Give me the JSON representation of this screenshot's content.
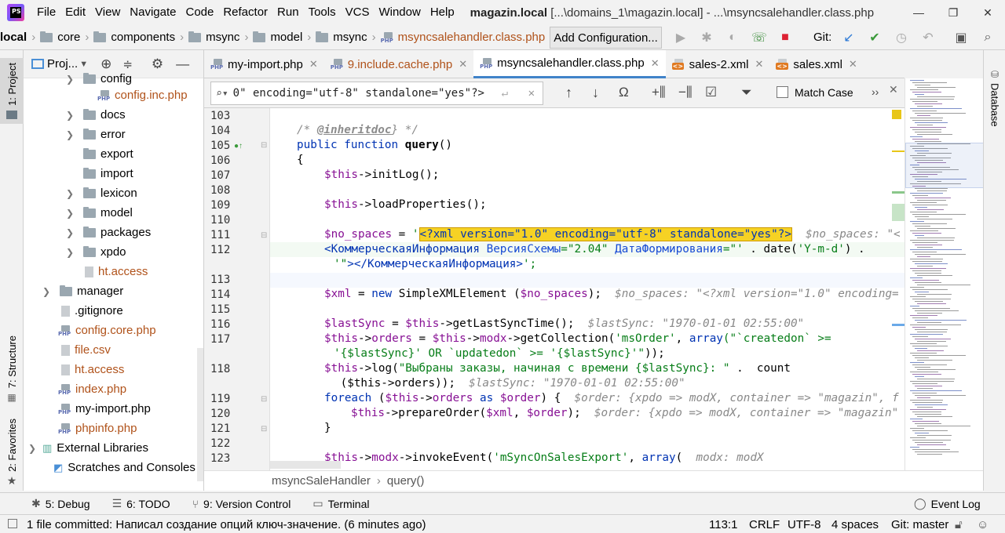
{
  "menu": {
    "items": [
      "File",
      "Edit",
      "View",
      "Navigate",
      "Code",
      "Refactor",
      "Run",
      "Tools",
      "VCS",
      "Window",
      "Help"
    ],
    "title_project": "magazin.local",
    "title_rest": " [...\\domains_1\\magazin.local] - ...\\msyncsalehandler.class.php"
  },
  "navbar": {
    "crumbs": [
      "local",
      "core",
      "components",
      "msync",
      "model",
      "msync",
      "msyncsalehandler.class.php"
    ],
    "add_config": "Add Configuration...",
    "git_label": "Git:"
  },
  "left_strip": {
    "project_tab": "1: Project",
    "structure_tab": "7: Structure",
    "favorites_tab": "2: Favorites"
  },
  "right_strip": {
    "database_tab": "Database"
  },
  "project": {
    "title": "Proj...",
    "tree": [
      {
        "label": "config",
        "kind": "folder",
        "depth": 2
      },
      {
        "label": "config.inc.php",
        "kind": "php",
        "depth": 3
      },
      {
        "label": "docs",
        "kind": "folder",
        "depth": 2
      },
      {
        "label": "error",
        "kind": "folder",
        "depth": 2
      },
      {
        "label": "export",
        "kind": "folder-plain",
        "depth": 2
      },
      {
        "label": "import",
        "kind": "folder-plain",
        "depth": 2
      },
      {
        "label": "lexicon",
        "kind": "folder",
        "depth": 2
      },
      {
        "label": "model",
        "kind": "folder",
        "depth": 2
      },
      {
        "label": "packages",
        "kind": "folder",
        "depth": 2
      },
      {
        "label": "xpdo",
        "kind": "folder",
        "depth": 2
      },
      {
        "label": "ht.access",
        "kind": "file-orange",
        "depth": 2
      },
      {
        "label": "manager",
        "kind": "folder",
        "depth": 1
      },
      {
        "label": ".gitignore",
        "kind": "file",
        "depth": 1
      },
      {
        "label": "config.core.php",
        "kind": "php",
        "depth": 1
      },
      {
        "label": "file.csv",
        "kind": "file-orange",
        "depth": 1
      },
      {
        "label": "ht.access",
        "kind": "file-orange",
        "depth": 1
      },
      {
        "label": "index.php",
        "kind": "php",
        "depth": 1
      },
      {
        "label": "my-import.php",
        "kind": "php-black",
        "depth": 1
      },
      {
        "label": "phpinfo.php",
        "kind": "php",
        "depth": 1
      },
      {
        "label": "External Libraries",
        "kind": "lib",
        "depth": 0
      },
      {
        "label": "Scratches and Consoles",
        "kind": "scratch",
        "depth": 0
      }
    ]
  },
  "tabs": [
    {
      "label": "my-import.php",
      "kind": "php",
      "active": false
    },
    {
      "label": "9.include.cache.php",
      "kind": "php",
      "active": false
    },
    {
      "label": "msyncsalehandler.class.php",
      "kind": "php",
      "active": true
    },
    {
      "label": "sales-2.xml",
      "kind": "xml",
      "active": false
    },
    {
      "label": "sales.xml",
      "kind": "xml",
      "active": false
    }
  ],
  "find": {
    "query": "0\" encoding=\"utf-8\" standalone=\"yes\"?>",
    "match_case": "Match Case"
  },
  "gutter": {
    "lines": [
      "103",
      "104",
      "105",
      "106",
      "107",
      "108",
      "109",
      "110",
      "111",
      "112",
      "",
      "113",
      "114",
      "115",
      "116",
      "117",
      "",
      "118",
      "",
      "119",
      "120",
      "121",
      "122",
      "123"
    ]
  },
  "code": {
    "l104_a": "/* ",
    "l104_tag": "@inheritdoc",
    "l104_b": "} */",
    "l105_kw1": "public",
    "l105_kw2": "function",
    "l105_fn": "query",
    "l105_rest": "()",
    "l106": "{",
    "l107_var": "$this",
    "l107_rest": "->initLog();",
    "l109_var": "$this",
    "l109_rest": "->loadProperties();",
    "l111_var": "$no_spaces",
    "l111_eq": " = ",
    "l111_q": "'",
    "l111_hl": "<?xml version=\"1.0\" encoding=\"utf-8\" standalone=\"yes\"?>",
    "l111_hint": "$no_spaces: \"<",
    "l112_tag_open": "<КоммерческаяИнформация",
    "l112_attr1": " ВерсияСхемы",
    "l112_val1": "=\"2.04\"",
    "l112_attr2": " ДатаФормирования",
    "l112_val2": "=\"",
    "l112_q": "'",
    "l112_rest": " . date(",
    "l112_str": "'Y-m-d'",
    "l112_end": ") .",
    "l112b_q": "'\"",
    "l112b_tag": "></КоммерческаяИнформация>",
    "l112b_end": "';",
    "l114_var": "$xml",
    "l114_eq": " = ",
    "l114_kw": "new",
    "l114_fn": " SimpleXMLElement (",
    "l114_var2": "$no_spaces",
    "l114_end": ");",
    "l114_hint": "$no_spaces: \"<?xml version=\"1.0\" encoding=",
    "l116_var": "$lastSync",
    "l116_eq": " = ",
    "l116_var2": "$this",
    "l116_rest": "->getLastSyncTime();",
    "l116_hint": "$lastSync: \"1970-01-01 02:55:00\"",
    "l117_var": "$this",
    "l117_p1": "->",
    "l117_prop": "orders",
    "l117_eq": " = ",
    "l117_var2": "$this",
    "l117_p2": "->",
    "l117_prop2": "modx",
    "l117_rest": "->getCollection(",
    "l117_str": "'msOrder'",
    "l117_c": ", ",
    "l117_kw": "array",
    "l117_str2": "(\"`createdon` >=",
    "l117b_str": "'{$lastSync}' OR `updatedon` >= '{$lastSync}'\"",
    "l117b_end": "));",
    "l118_var": "$this",
    "l118_rest": "->log(",
    "l118_str": "\"Выбраны заказы, начиная с времени {$lastSync}: \"",
    "l118_dot": " .  count",
    "l118b": " ($this->orders));",
    "l118b_hint": "$lastSync: \"1970-01-01 02:55:00\"",
    "l119_kw": "foreach",
    "l119_a": " (",
    "l119_var": "$this",
    "l119_p": "->",
    "l119_prop": "orders",
    "l119_kw2": " as ",
    "l119_var2": "$order",
    "l119_end": ") {",
    "l119_hint": "$order: {xpdo => modX, container => \"magazin\", f",
    "l120_var": "$this",
    "l120_rest": "->prepareOrder(",
    "l120_var2": "$xml",
    "l120_c": ", ",
    "l120_var3": "$order",
    "l120_end": ");",
    "l120_hint": "$order: {xpdo => modX, container => \"magazin\"",
    "l121": "}",
    "l123_var": "$this",
    "l123_p": "->",
    "l123_prop": "modx",
    "l123_rest": "->invokeEvent(",
    "l123_str": "'mSyncOnSalesExport'",
    "l123_c": ", ",
    "l123_kw": "array",
    "l123_end": "(",
    "l123_hint": "modx: modX"
  },
  "editor_crumbs": {
    "class": "msyncSaleHandler",
    "method": "query()"
  },
  "bottom_tools": [
    {
      "label": "5: Debug",
      "icon": "bug-icon"
    },
    {
      "label": "6: TODO",
      "icon": "todo-icon"
    },
    {
      "label": "9: Version Control",
      "icon": "vcs-icon"
    },
    {
      "label": "Terminal",
      "icon": "terminal-icon"
    }
  ],
  "event_log": "Event Log",
  "status": {
    "message": "1 file committed: Написал создание опций ключ-значение. (6 minutes ago)",
    "position": "113:1",
    "line_sep": "CRLF",
    "encoding": "UTF-8",
    "indent": "4 spaces",
    "branch": "Git: master"
  },
  "colors": {
    "accent": "#4083c9",
    "highlight": "#f6d224"
  }
}
